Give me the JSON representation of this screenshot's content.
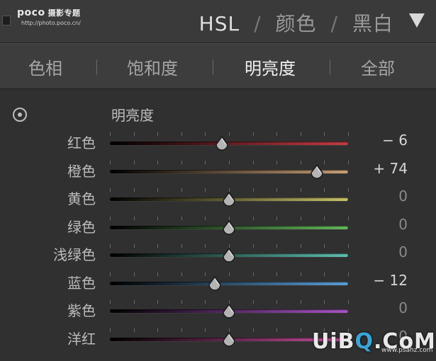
{
  "header": {
    "logo": "poco",
    "logo_cn": "摄影专题",
    "logo_url": "http://photo.poco.cn/",
    "modes": [
      "HSL",
      "颜色",
      "黑白"
    ],
    "separator": "/"
  },
  "subtabs": [
    "色相",
    "饱和度",
    "明亮度",
    "全部"
  ],
  "active_subtab": "明亮度",
  "section_title": "明亮度",
  "sliders": [
    {
      "label": "红色",
      "value": "− 6",
      "level": -6,
      "colors": [
        "#000000",
        "#c23b45"
      ]
    },
    {
      "label": "橙色",
      "value": "+ 74",
      "level": 74,
      "colors": [
        "#000000",
        "#c9a076"
      ]
    },
    {
      "label": "黄色",
      "value": "0",
      "level": 0,
      "colors": [
        "#000000",
        "#c8c16a"
      ]
    },
    {
      "label": "绿色",
      "value": "0",
      "level": 0,
      "colors": [
        "#000000",
        "#64b85b"
      ]
    },
    {
      "label": "浅绿色",
      "value": "0",
      "level": 0,
      "colors": [
        "#000000",
        "#5fbfae"
      ]
    },
    {
      "label": "蓝色",
      "value": "− 12",
      "level": -12,
      "colors": [
        "#000000",
        "#5a9ed6"
      ]
    },
    {
      "label": "紫色",
      "value": "0",
      "level": 0,
      "colors": [
        "#000000",
        "#a853c4"
      ]
    },
    {
      "label": "洋红",
      "value": "0",
      "level": 0,
      "colors": [
        "#000000",
        "#c84d9a"
      ]
    }
  ],
  "watermark": {
    "text_a": "UiB",
    "text_o": "Q",
    "text_b": ".CoM",
    "url": "www.psahz.com"
  }
}
